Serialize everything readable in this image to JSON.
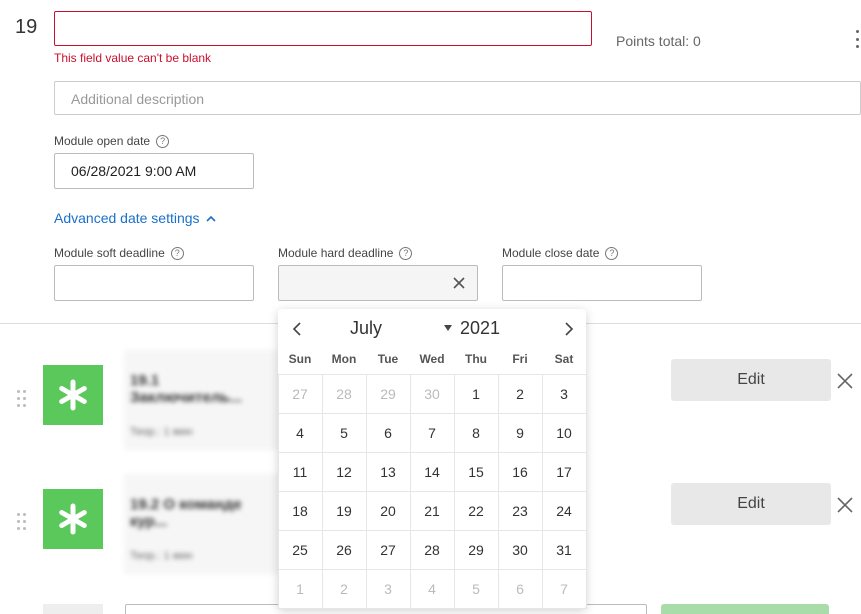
{
  "module": {
    "number": "19",
    "title_value": "",
    "error": "This field value can't be blank",
    "points_total": "Points total: 0",
    "description_placeholder": "Additional description"
  },
  "open_date": {
    "label": "Module open date",
    "value": "06/28/2021 9:00 AM"
  },
  "advanced_link": "Advanced date settings",
  "deadlines": {
    "soft_label": "Module soft deadline",
    "hard_label": "Module hard deadline",
    "close_label": "Module close date"
  },
  "calendar": {
    "month": "July",
    "year": "2021",
    "weekdays": [
      "Sun",
      "Mon",
      "Tue",
      "Wed",
      "Thu",
      "Fri",
      "Sat"
    ],
    "weeks": [
      [
        [
          "27",
          true
        ],
        [
          "28",
          true
        ],
        [
          "29",
          true
        ],
        [
          "30",
          true
        ],
        [
          "1",
          false
        ],
        [
          "2",
          false
        ],
        [
          "3",
          false
        ]
      ],
      [
        [
          "4",
          false
        ],
        [
          "5",
          false
        ],
        [
          "6",
          false
        ],
        [
          "7",
          false
        ],
        [
          "8",
          false
        ],
        [
          "9",
          false
        ],
        [
          "10",
          false
        ]
      ],
      [
        [
          "11",
          false
        ],
        [
          "12",
          false
        ],
        [
          "13",
          false
        ],
        [
          "14",
          false
        ],
        [
          "15",
          false
        ],
        [
          "16",
          false
        ],
        [
          "17",
          false
        ]
      ],
      [
        [
          "18",
          false
        ],
        [
          "19",
          false
        ],
        [
          "20",
          false
        ],
        [
          "21",
          false
        ],
        [
          "22",
          false
        ],
        [
          "23",
          false
        ],
        [
          "24",
          false
        ]
      ],
      [
        [
          "25",
          false
        ],
        [
          "26",
          false
        ],
        [
          "27",
          false
        ],
        [
          "28",
          false
        ],
        [
          "29",
          false
        ],
        [
          "30",
          false
        ],
        [
          "31",
          false
        ]
      ],
      [
        [
          "1",
          true
        ],
        [
          "2",
          true
        ],
        [
          "3",
          true
        ],
        [
          "4",
          true
        ],
        [
          "5",
          true
        ],
        [
          "6",
          true
        ],
        [
          "7",
          true
        ]
      ]
    ],
    "today": "8"
  },
  "lessons": [
    {
      "title": "19.1 Заключитель...",
      "subtitle": "Теор.: 1 мин",
      "edit_label": "Edit"
    },
    {
      "title": "19.2 О команде кур...",
      "subtitle": "Теор.: 1 мин",
      "edit_label": "Edit"
    }
  ],
  "icons": {
    "help": "question-circle-icon",
    "chevron_up": "chevron-up-icon",
    "clear": "close-icon",
    "drag": "drag-handle-icon",
    "tile": "asterisk-icon",
    "kebab": "more-vertical-icon"
  },
  "colors": {
    "error": "#c8102e",
    "link": "#1a6fc9",
    "tile_green": "#5ac85a",
    "today_underline": "#3d6bd0"
  }
}
